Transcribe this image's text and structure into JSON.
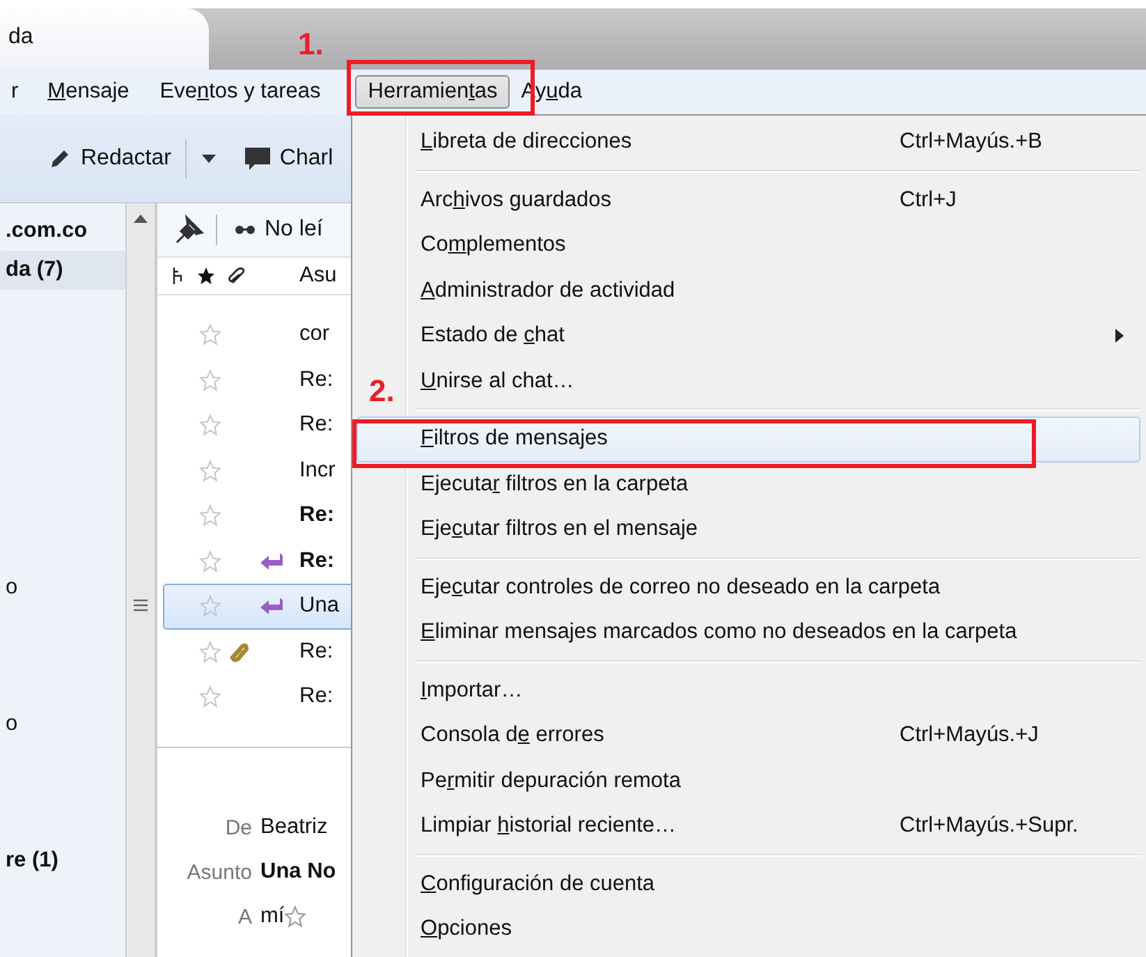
{
  "tab": {
    "title": "da"
  },
  "menubar": [
    {
      "parts": {
        "pre": "r"
      },
      "selected": false
    },
    {
      "parts": {
        "key": "M",
        "post": "ensaje"
      },
      "selected": false
    },
    {
      "parts": {
        "pre": "Eve",
        "key": "n",
        "post": "tos y tareas"
      },
      "selected": false
    },
    {
      "parts": {
        "pre": "Herramien",
        "key": "t",
        "post": "as"
      },
      "selected": true,
      "callout": "1."
    },
    {
      "parts": {
        "pre": "Ay",
        "key": "u",
        "post": "da"
      },
      "selected": false
    }
  ],
  "toolbar": {
    "compose": "Redactar",
    "chat": "Charl"
  },
  "folders": [
    {
      "name": ".com.co",
      "bold": true,
      "selected": false
    },
    {
      "name": "da (7)",
      "bold": true,
      "selected": true
    },
    {
      "name": "o",
      "bold": false,
      "selected": false
    },
    {
      "name": "o",
      "bold": false,
      "selected": false
    },
    {
      "name": "re (1)",
      "bold": true,
      "selected": false
    }
  ],
  "message_list": {
    "filter": "No leí",
    "subject_column": "Asu",
    "rows": [
      {
        "subject": "cor",
        "bold": false,
        "replied": false,
        "attachment": false,
        "starred": false,
        "selected": false
      },
      {
        "subject": "Re:",
        "bold": false,
        "replied": false,
        "attachment": false,
        "starred": false,
        "selected": false
      },
      {
        "subject": "Re:",
        "bold": false,
        "replied": false,
        "attachment": false,
        "starred": false,
        "selected": false
      },
      {
        "subject": "Incr",
        "bold": false,
        "replied": false,
        "attachment": false,
        "starred": false,
        "selected": false
      },
      {
        "subject": "Re:",
        "bold": true,
        "replied": false,
        "attachment": false,
        "starred": false,
        "selected": false
      },
      {
        "subject": "Re:",
        "bold": true,
        "replied": true,
        "attachment": false,
        "starred": false,
        "selected": false
      },
      {
        "subject": "Una",
        "bold": false,
        "replied": true,
        "attachment": false,
        "starred": false,
        "selected": true
      },
      {
        "subject": "Re:",
        "bold": false,
        "replied": false,
        "attachment": true,
        "starred": false,
        "selected": false
      },
      {
        "subject": "Re:",
        "bold": false,
        "replied": false,
        "attachment": false,
        "starred": false,
        "selected": false
      }
    ]
  },
  "message_header": [
    {
      "label": "De",
      "value": "Beatriz",
      "bold": false,
      "star": false
    },
    {
      "label": "Asunto",
      "value": "Una No",
      "bold": true,
      "star": false
    },
    {
      "label": "A",
      "value": "mí",
      "bold": false,
      "star": true
    }
  ],
  "menu": {
    "sections": [
      {
        "items": [
          {
            "parts": {
              "key": "L",
              "post": "ibreta de direcciones"
            },
            "shortcut": "Ctrl+Mayús.+B",
            "submenu": false,
            "selected": false
          }
        ]
      },
      {
        "items": [
          {
            "parts": {
              "pre": "Arc",
              "key": "h",
              "post": "ivos guardados"
            },
            "shortcut": "Ctrl+J",
            "submenu": false,
            "selected": false
          },
          {
            "parts": {
              "pre": "Co",
              "key": "m",
              "post": "plementos"
            },
            "submenu": false,
            "selected": false
          },
          {
            "parts": {
              "key": "A",
              "post": "dministrador de actividad"
            },
            "submenu": false,
            "selected": false
          },
          {
            "parts": {
              "pre": "Estado de ",
              "key": "c",
              "post": "hat"
            },
            "submenu": true,
            "selected": false
          },
          {
            "parts": {
              "key": "U",
              "post": "nirse al chat…"
            },
            "submenu": false,
            "selected": false
          }
        ]
      },
      {
        "items": [
          {
            "parts": {
              "key": "F",
              "post": "iltros de mensajes"
            },
            "submenu": false,
            "selected": true,
            "callout": "2."
          },
          {
            "parts": {
              "pre": "Ejecuta",
              "key": "r",
              "post": " filtros en la carpeta"
            },
            "submenu": false,
            "selected": false
          },
          {
            "parts": {
              "pre": "Eje",
              "key": "c",
              "post": "utar filtros en el mensaje"
            },
            "submenu": false,
            "selected": false
          }
        ]
      },
      {
        "items": [
          {
            "parts": {
              "pre": "Eje",
              "key": "c",
              "post": "utar controles de correo no deseado en la carpeta"
            },
            "submenu": false,
            "selected": false
          },
          {
            "parts": {
              "key": "E",
              "post": "liminar mensajes marcados como no deseados en la carpeta"
            },
            "submenu": false,
            "selected": false
          }
        ]
      },
      {
        "items": [
          {
            "parts": {
              "key": "I",
              "post": "mportar…"
            },
            "submenu": false,
            "selected": false
          },
          {
            "parts": {
              "pre": "Consola d",
              "key": "e",
              "post": " errores"
            },
            "shortcut": "Ctrl+Mayús.+J",
            "submenu": false,
            "selected": false
          },
          {
            "parts": {
              "pre": "Pe",
              "key": "r",
              "post": "mitir depuración remota"
            },
            "submenu": false,
            "selected": false
          },
          {
            "parts": {
              "pre": "Limpiar ",
              "key": "h",
              "post": "istorial reciente…"
            },
            "shortcut": "Ctrl+Mayús.+Supr.",
            "submenu": false,
            "selected": false
          }
        ]
      },
      {
        "items": [
          {
            "parts": {
              "key": "C",
              "post": "onfiguración de cuenta"
            },
            "submenu": false,
            "selected": false
          },
          {
            "parts": {
              "key": "O",
              "post": "pciones"
            },
            "submenu": false,
            "selected": false
          }
        ]
      }
    ]
  }
}
